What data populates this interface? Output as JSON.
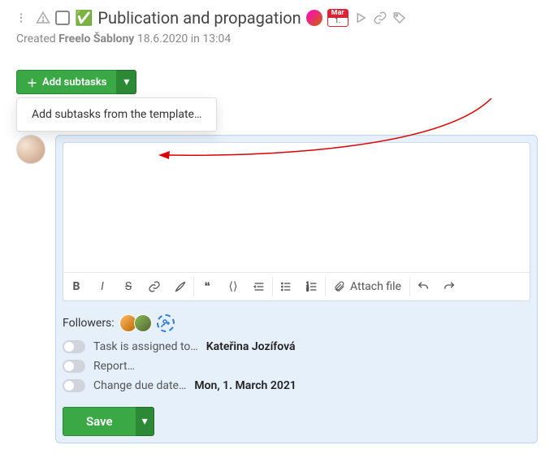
{
  "task": {
    "emoji": "✅",
    "title": "Publication and propagation",
    "badge_top": "Mar",
    "badge_bottom": "1."
  },
  "meta": {
    "created_label": "Created",
    "author": "Freelo Šablony",
    "timestamp": "18.6.2020 in 13:04"
  },
  "addsub": {
    "label": "Add subtasks",
    "dropdown_item": "Add subtasks from the template…"
  },
  "toolbar": {
    "attach_label": "Attach file"
  },
  "followers_label": "Followers:",
  "options": {
    "assign_label": "Task is assigned to…",
    "assign_value": "Kateřina Jozífová",
    "report_label": "Report…",
    "due_label": "Change due date…",
    "due_value": "Mon, 1. March 2021"
  },
  "save_label": "Save"
}
